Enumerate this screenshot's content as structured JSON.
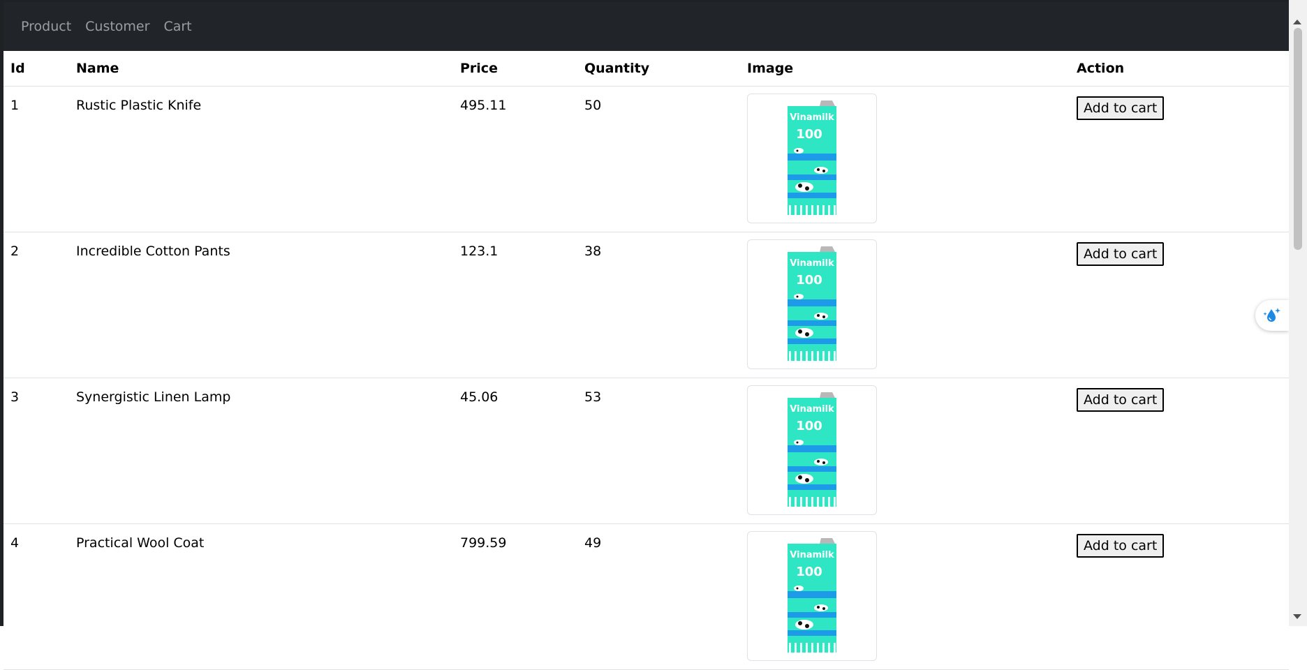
{
  "nav": {
    "links": [
      "Product",
      "Customer",
      "Cart"
    ]
  },
  "table": {
    "headers": [
      "Id",
      "Name",
      "Price",
      "Quantity",
      "Image",
      "Action"
    ],
    "rows": [
      {
        "id": "1",
        "name": "Rustic Plastic Knife",
        "price": "495.11",
        "quantity": "50",
        "image": "vinamilk-carton",
        "action": "Add to cart"
      },
      {
        "id": "2",
        "name": "Incredible Cotton Pants",
        "price": "123.1",
        "quantity": "38",
        "image": "vinamilk-carton",
        "action": "Add to cart"
      },
      {
        "id": "3",
        "name": "Synergistic Linen Lamp",
        "price": "45.06",
        "quantity": "53",
        "image": "vinamilk-carton",
        "action": "Add to cart"
      },
      {
        "id": "4",
        "name": "Practical Wool Coat",
        "price": "799.59",
        "quantity": "49",
        "image": "vinamilk-carton",
        "action": "Add to cart"
      }
    ]
  },
  "product_image": {
    "brand_text": "Vinamilk",
    "percent_text": "100",
    "colors": {
      "carton": "#2ee6c4",
      "stripe": "#1e9be8",
      "dark": "#0a6e5c"
    }
  },
  "floating_widget": {
    "icon": "water-drop-sparkle-icon"
  }
}
